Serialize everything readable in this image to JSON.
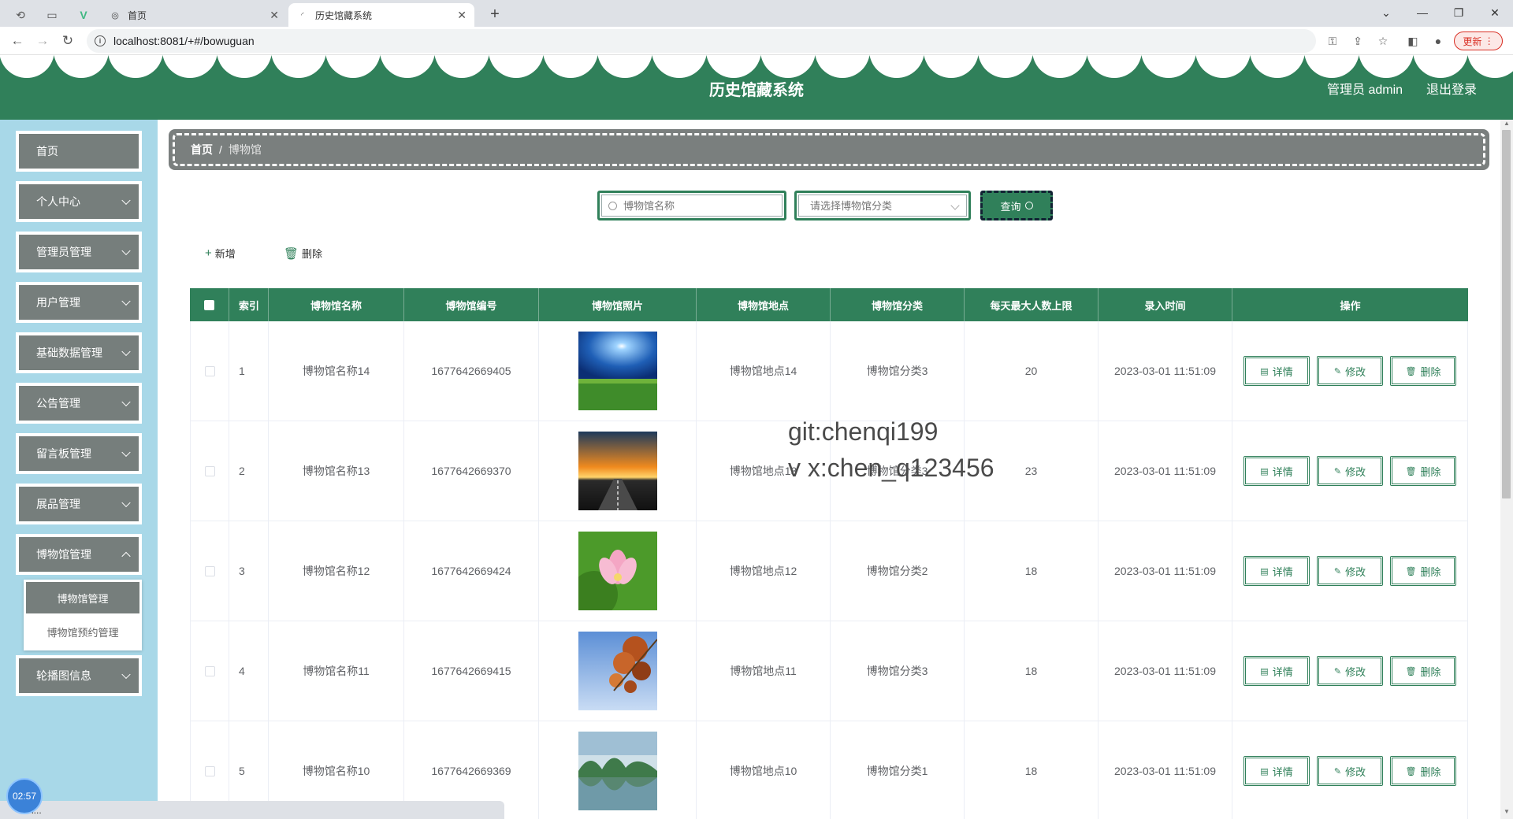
{
  "browser": {
    "tabs": [
      {
        "label": "首页"
      },
      {
        "label": "历史馆藏系统"
      }
    ],
    "url": "localhost:8081/+#/bowuguan",
    "update_label": "更新"
  },
  "header": {
    "title": "历史馆藏系统",
    "admin": "管理员 admin",
    "logout": "退出登录",
    "color": "#30805a"
  },
  "sidebar": {
    "items": [
      {
        "label": "首页"
      },
      {
        "label": "个人中心"
      },
      {
        "label": "管理员管理"
      },
      {
        "label": "用户管理"
      },
      {
        "label": "基础数据管理"
      },
      {
        "label": "公告管理"
      },
      {
        "label": "留言板管理"
      },
      {
        "label": "展品管理"
      },
      {
        "label": "博物馆管理"
      },
      {
        "label": "轮播图信息"
      }
    ],
    "submenu": [
      {
        "label": "博物馆管理"
      },
      {
        "label": "博物馆预约管理"
      }
    ]
  },
  "breadcrumb": {
    "home": "首页",
    "sep": "/",
    "current": "博物馆"
  },
  "search": {
    "name_placeholder": "博物馆名称",
    "category_placeholder": "请选择博物馆分类",
    "query_label": "查询"
  },
  "actions": {
    "add": "新增",
    "delete": "删除"
  },
  "table": {
    "headers": [
      "索引",
      "博物馆名称",
      "博物馆编号",
      "博物馆照片",
      "博物馆地点",
      "博物馆分类",
      "每天最大人数上限",
      "录入时间",
      "操作"
    ],
    "rows": [
      {
        "index": "1",
        "name": "博物馆名称14",
        "code": "1677642669405",
        "location": "博物馆地点14",
        "category": "博物馆分类3",
        "max": "20",
        "time": "2023-03-01 11:51:09",
        "photo": "sky-field"
      },
      {
        "index": "2",
        "name": "博物馆名称13",
        "code": "1677642669370",
        "location": "博物馆地点13",
        "category": "博物馆分类3",
        "max": "23",
        "time": "2023-03-01 11:51:09",
        "photo": "sunset-road"
      },
      {
        "index": "3",
        "name": "博物馆名称12",
        "code": "1677642669424",
        "location": "博物馆地点12",
        "category": "博物馆分类2",
        "max": "18",
        "time": "2023-03-01 11:51:09",
        "photo": "lotus"
      },
      {
        "index": "4",
        "name": "博物馆名称11",
        "code": "1677642669415",
        "location": "博物馆地点11",
        "category": "博物馆分类3",
        "max": "18",
        "time": "2023-03-01 11:51:09",
        "photo": "autumn-leaves"
      },
      {
        "index": "5",
        "name": "博物馆名称10",
        "code": "1677642669369",
        "location": "博物馆地点10",
        "category": "博物馆分类1",
        "max": "18",
        "time": "2023-03-01 11:51:09",
        "photo": "lake-mountains"
      }
    ],
    "op_labels": {
      "detail": "详情",
      "edit": "修改",
      "delete": "删除"
    }
  },
  "watermark": [
    "git:chenqi199",
    "v x:chen_q123456"
  ],
  "clock": "02:57",
  "status": "i..."
}
